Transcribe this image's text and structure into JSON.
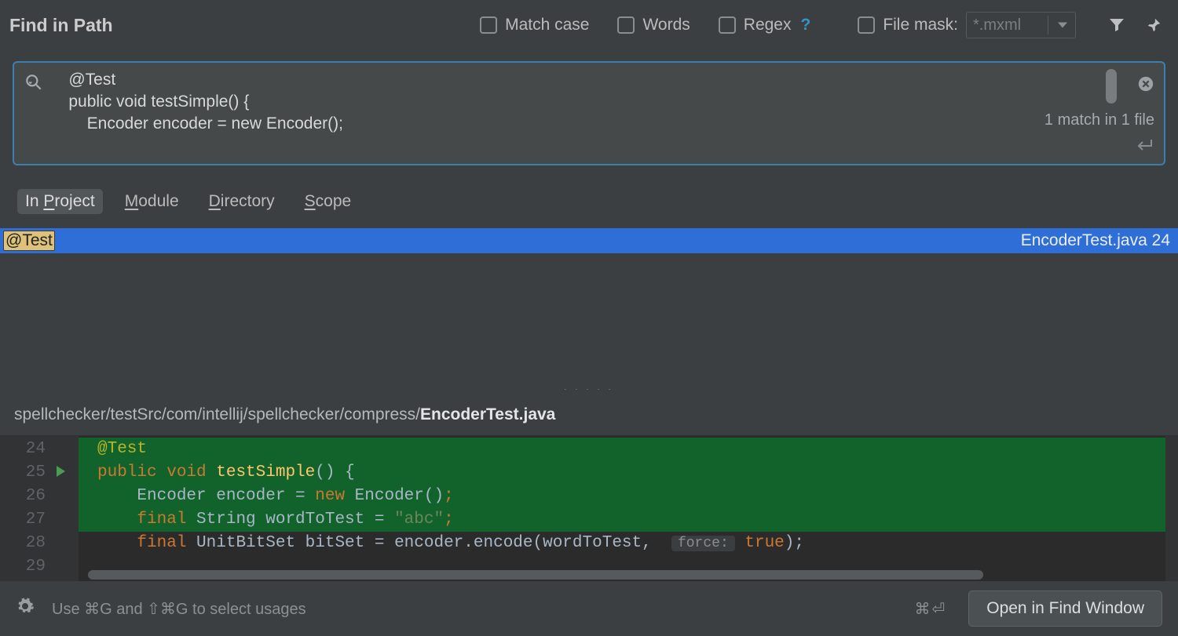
{
  "header": {
    "title": "Find in Path",
    "match_case": "Match case",
    "words": "Words",
    "regex": "Regex",
    "regex_help": "?",
    "file_mask_label": "File mask:",
    "file_mask_value": "*.mxml"
  },
  "search": {
    "query": "    @Test\n    public void testSimple() {\n        Encoder encoder = new Encoder();",
    "match_count": "1 match in 1 file"
  },
  "scope": {
    "in_project": "In Project",
    "module": "Module",
    "directory": "Directory",
    "scope": "Scope"
  },
  "result": {
    "snippet": "@Test",
    "file": "EncoderTest.java",
    "line": "24"
  },
  "path": {
    "prefix": "spellchecker/testSrc/com/intellij/spellchecker/compress/",
    "file": "EncoderTest.java"
  },
  "editor": {
    "lines": [
      "24",
      "25",
      "26",
      "27",
      "28",
      "29"
    ],
    "l24_ann": "@Test",
    "l25_kw1": "public ",
    "l25_kw2": "void ",
    "l25_mth": "testSimple",
    "l25_tail": "() {",
    "l26_a": "    Encoder encoder = ",
    "l26_new": "new ",
    "l26_b": "Encoder()",
    "l26_semi": ";",
    "l27_final": "    final ",
    "l27_a": "String wordToTest = ",
    "l27_str": "\"abc\"",
    "l27_semi": ";",
    "l28_final": "    final ",
    "l28_a": "UnitBitSet bitSet = encoder.encode(wordToTest,  ",
    "l28_hint": "force:",
    "l28_sp": " ",
    "l28_true": "true",
    "l28_tail": ");"
  },
  "footer": {
    "hint": "Use ⌘G and ⇧⌘G to select usages",
    "shortcut": "⌘⏎",
    "open": "Open in Find Window"
  }
}
